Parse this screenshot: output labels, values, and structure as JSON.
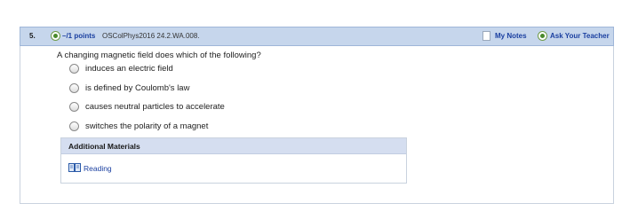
{
  "question": {
    "number": "5.",
    "points": "–/1 points",
    "source": "OSColPhys2016 24.2.WA.008.",
    "prompt": "A changing magnetic field does which of the following?",
    "choices": [
      {
        "label": "induces an electric field"
      },
      {
        "label": "is defined by Coulomb's law"
      },
      {
        "label": "causes neutral particles to accelerate"
      },
      {
        "label": "switches the polarity of a magnet"
      }
    ]
  },
  "header_actions": {
    "my_notes": "My Notes",
    "ask_teacher": "Ask Your Teacher"
  },
  "additional_materials": {
    "title": "Additional Materials",
    "links": [
      {
        "label": "Reading",
        "icon": "book-icon"
      }
    ]
  },
  "colors": {
    "header_bg": "#c6d6ec",
    "link": "#1a3fa0",
    "accent_green": "#4a8a2b"
  }
}
